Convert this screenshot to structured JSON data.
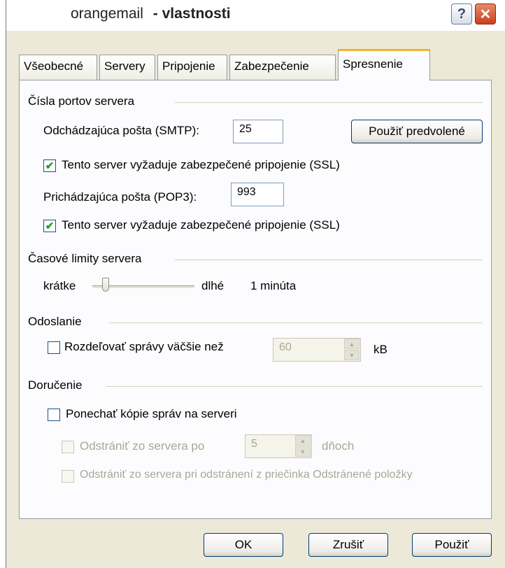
{
  "window": {
    "title_app": "orangemail",
    "title_suffix": "- vlastnosti",
    "help_label": "?",
    "close_label": "✕"
  },
  "tabs": [
    {
      "label": "Všeobecné"
    },
    {
      "label": "Servery"
    },
    {
      "label": "Pripojenie"
    },
    {
      "label": "Zabezpečenie"
    },
    {
      "label": "Spresnenie"
    }
  ],
  "active_tab": "Spresnenie",
  "ports": {
    "group_title": "Čísla portov servera",
    "smtp_label": "Odchádzajúca pošta (SMTP):",
    "smtp_value": "25",
    "default_button": "Použiť predvolené",
    "smtp_ssl_label": "Tento server vyžaduje zabezpečené pripojenie (SSL)",
    "pop3_label": "Prichádzajúca pošta (POP3):",
    "pop3_value": "993",
    "pop3_ssl_label": "Tento server vyžaduje zabezpečené pripojenie (SSL)",
    "smtp_ssl_checked": true,
    "pop3_ssl_checked": true
  },
  "timeouts": {
    "group_title": "Časové limity servera",
    "short_label": "krátke",
    "long_label": "dlhé",
    "value_text": "1 minúta",
    "slider_level": 0.1
  },
  "sending": {
    "group_title": "Odoslanie",
    "split_label": "Rozdeľovať správy väčšie než",
    "split_checked": false,
    "split_value": "60",
    "unit": "kB"
  },
  "delivery": {
    "group_title": "Doručenie",
    "keep_copies_label": "Ponechať kópie správ na serveri",
    "keep_copies_checked": false,
    "remove_after_label": "Odstrániť zo servera po",
    "remove_after_value": "5",
    "days_label": "dňoch",
    "remove_on_delete_label": "Odstrániť zo servera pri odstránení z priečinka Odstránené položky"
  },
  "footer": {
    "ok": "OK",
    "cancel": "Zrušiť",
    "apply": "Použiť"
  },
  "colors": {
    "dialog_bg": "#ece9d8",
    "panel_bg": "#fcfcfe",
    "active_tab_accent": "#f0b430",
    "check_green": "#21a121",
    "disabled_text": "#a7a797"
  }
}
